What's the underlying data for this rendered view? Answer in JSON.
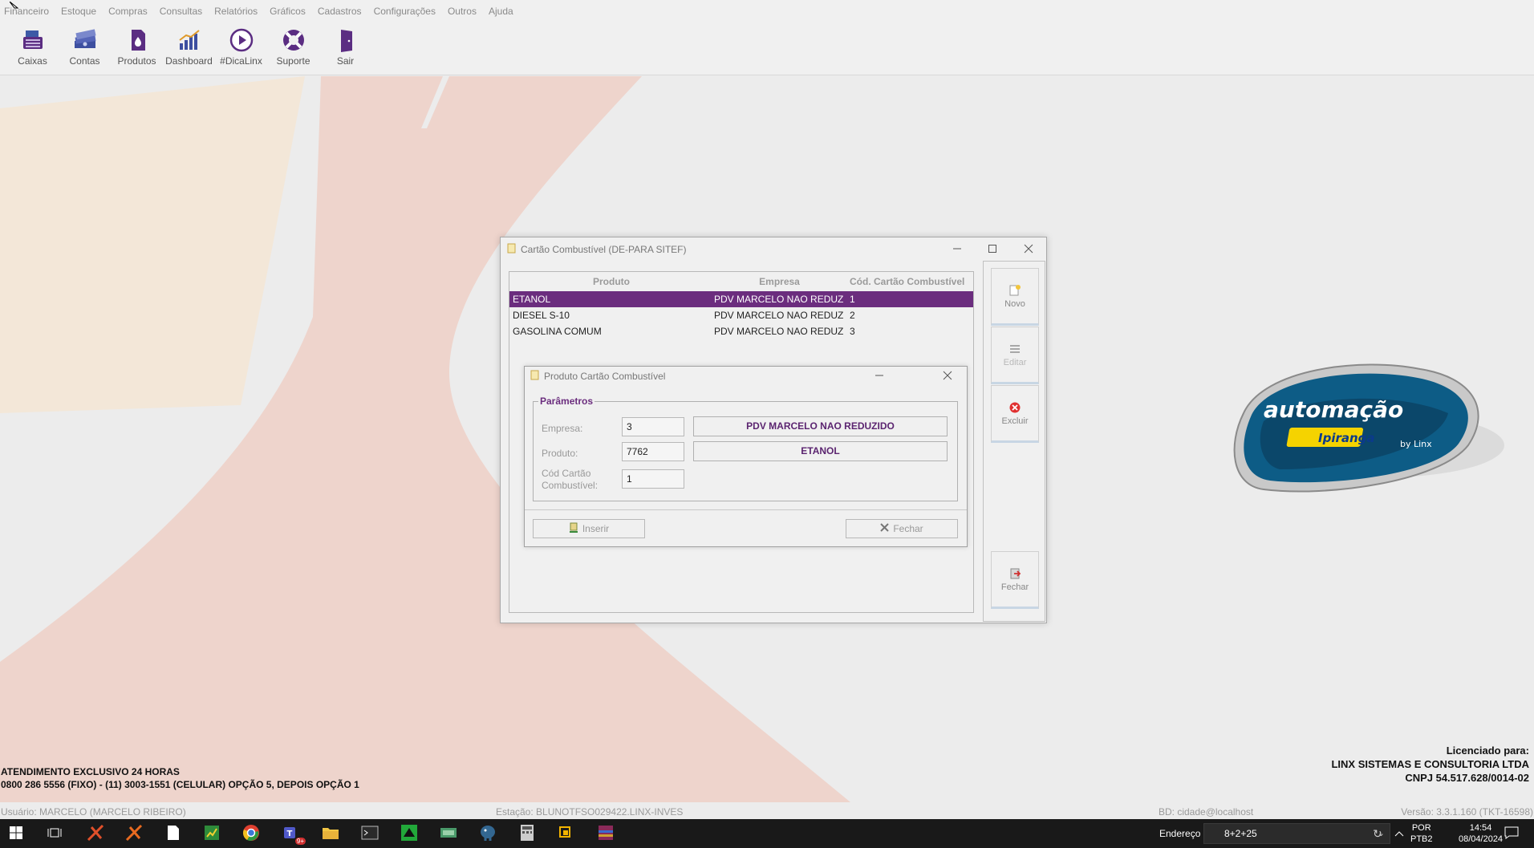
{
  "menu": [
    "Financeiro",
    "Estoque",
    "Compras",
    "Consultas",
    "Relatórios",
    "Gráficos",
    "Cadastros",
    "Configurações",
    "Outros",
    "Ajuda"
  ],
  "toolbar": [
    {
      "label": "Caixas",
      "icon": "cash-register-icon"
    },
    {
      "label": "Contas",
      "icon": "money-stack-icon"
    },
    {
      "label": "Produtos",
      "icon": "fuel-drop-icon"
    },
    {
      "label": "Dashboard",
      "icon": "bar-chart-icon"
    },
    {
      "label": "#DicaLinx",
      "icon": "play-icon"
    },
    {
      "label": "Suporte",
      "icon": "lifebuoy-icon"
    },
    {
      "label": "Sair",
      "icon": "exit-door-icon"
    }
  ],
  "main_window": {
    "title": "Cartão Combustível (DE-PARA SITEF)",
    "grid": {
      "columns": [
        "Produto",
        "Empresa",
        "Cód. Cartão Combustível"
      ],
      "rows": [
        {
          "produto": "ETANOL",
          "empresa": "PDV MARCELO NAO REDUZ",
          "codigo": "1",
          "selected": true
        },
        {
          "produto": "DIESEL S-10",
          "empresa": "PDV MARCELO NAO REDUZ",
          "codigo": "2",
          "selected": false
        },
        {
          "produto": "GASOLINA COMUM",
          "empresa": "PDV MARCELO NAO REDUZ",
          "codigo": "3",
          "selected": false
        }
      ]
    },
    "side_buttons": {
      "novo": "Novo",
      "editar": "Editar",
      "excluir": "Excluir",
      "fechar": "Fechar"
    }
  },
  "dialog": {
    "title": "Produto Cartão Combustível",
    "group": "Parâmetros",
    "empresa_label": "Empresa:",
    "empresa_value": "3",
    "empresa_name": "PDV MARCELO NAO REDUZIDO",
    "produto_label": "Produto:",
    "produto_value": "7762",
    "produto_name": "ETANOL",
    "cod_label_1": "Cód Cartão",
    "cod_label_2": "Combustível:",
    "cod_value": "1",
    "inserir": "Inserir",
    "fechar": "Fechar"
  },
  "support": {
    "line1": "ATENDIMENTO EXCLUSIVO 24 HORAS",
    "line2": "0800 286 5556 (FIXO) - (11) 3003-1551 (CELULAR) OPÇÃO 5, DEPOIS OPÇÃO 1"
  },
  "license": {
    "line1": "Licenciado para:",
    "line2": "LINX SISTEMAS E CONSULTORIA LTDA",
    "line3": "CNPJ 54.517.628/0014-02"
  },
  "logo": {
    "main": "automação",
    "brand": "Ipiranga",
    "by": "by Linx"
  },
  "status": {
    "usuario": "Usuário: MARCELO (MARCELO RIBEIRO)",
    "estacao": "Estação: BLUNOTFSO029422.LINX-INVES",
    "bd": "BD: cidade@localhost",
    "versao": "Versão: 3.3.1.160 (TKT-16598)"
  },
  "taskbar": {
    "address_label": "Endereço",
    "address_value": "8+2+25",
    "teams_badge": "9+",
    "lang1": "POR",
    "lang2": "PTB2",
    "time": "14:54",
    "date": "08/04/2024"
  },
  "colors": {
    "accent": "#6b2d7e",
    "accent_text": "#5b2470",
    "taskbar": "#191919"
  }
}
